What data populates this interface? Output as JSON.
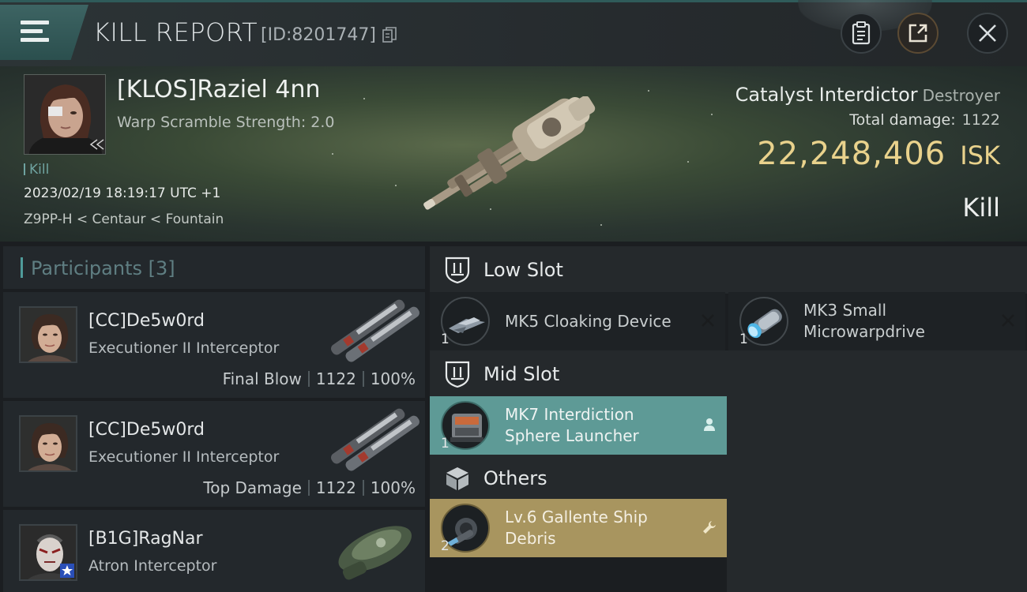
{
  "header": {
    "title": "KILL REPORT",
    "id_text": "[ID:8201747]"
  },
  "victim": {
    "name": "[KLOS]Raziel 4nn",
    "subtitle": "Warp Scramble Strength: 2.0",
    "tag": "Kill",
    "datetime": "2023/02/19 18:19:17 UTC +1",
    "location": "Z9PP-H < Centaur < Fountain",
    "ship_name": "Catalyst Interdictor",
    "ship_class": "Destroyer",
    "total_damage_label": "Total damage:",
    "total_damage_value": "1122",
    "isk_value": "22,248,406",
    "isk_unit": "ISK",
    "result": "Kill"
  },
  "participants": {
    "label": "Participants",
    "count": "[3]",
    "items": [
      {
        "name": "[CC]De5w0rd",
        "ship": "Executioner II Interceptor",
        "role": "Final Blow",
        "damage": "1122",
        "percent": "100%"
      },
      {
        "name": "[CC]De5w0rd",
        "ship": "Executioner II Interceptor",
        "role": "Top Damage",
        "damage": "1122",
        "percent": "100%"
      },
      {
        "name": "[B1G]RagNar",
        "ship": "Atron Interceptor"
      }
    ]
  },
  "slots": {
    "low": {
      "label": "Low Slot",
      "items": [
        {
          "name": "MK5 Cloaking Device",
          "qty": "1",
          "status": "destroyed"
        },
        {
          "name_line1": "MK3 Small",
          "name_line2": "Microwarpdrive",
          "qty": "1",
          "status": "destroyed"
        }
      ]
    },
    "mid": {
      "label": "Mid Slot",
      "items": [
        {
          "name_line1": "MK7 Interdiction",
          "name_line2": "Sphere Launcher",
          "qty": "1",
          "status": "dropped",
          "icon": "person-icon"
        }
      ]
    },
    "others": {
      "label": "Others",
      "items": [
        {
          "name_line1": "Lv.6 Gallente Ship",
          "name_line2": "Debris",
          "qty": "2",
          "status": "dropped",
          "icon": "wrench-icon"
        }
      ]
    }
  },
  "colors": {
    "accent_teal": "#4f9b9a",
    "isk_gold": "#e9d28c",
    "dropped_teal": "#5e9a96",
    "dropped_gold": "#a8955f"
  }
}
